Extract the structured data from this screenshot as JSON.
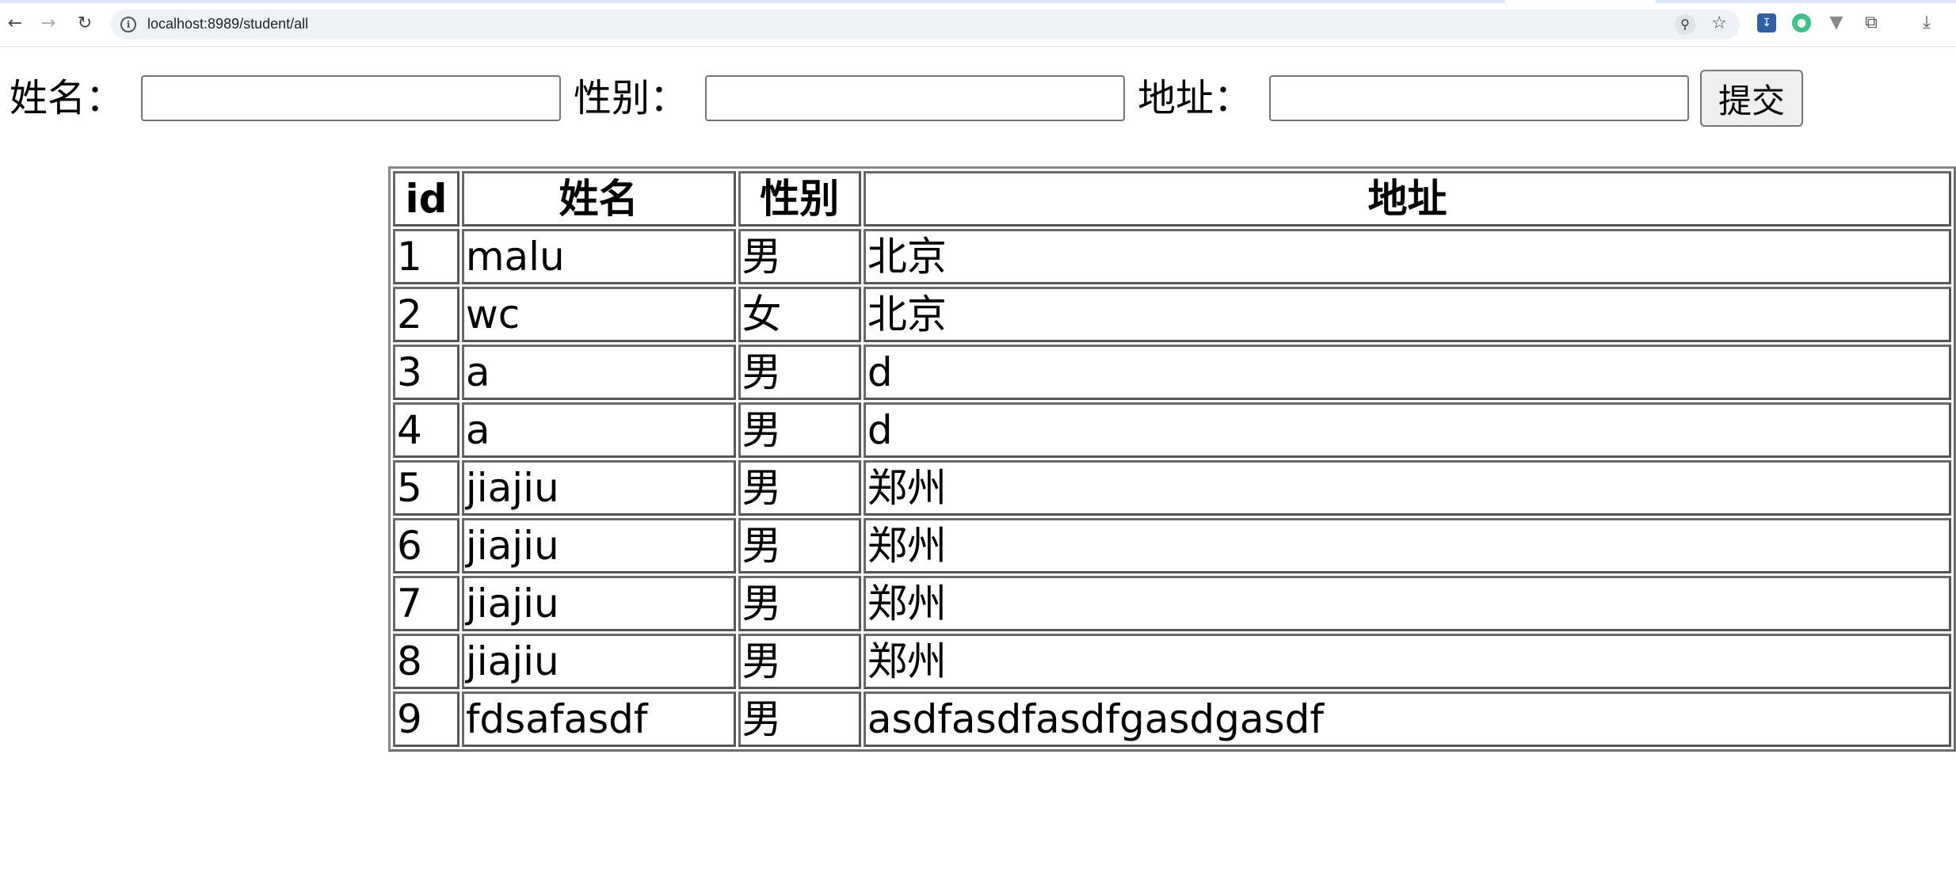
{
  "browser": {
    "url": "localhost:8989/student/all"
  },
  "form": {
    "name_label": "姓名：",
    "gender_label": "性别：",
    "address_label": "地址：",
    "name_value": "",
    "gender_value": "",
    "address_value": "",
    "submit_label": "提交"
  },
  "table": {
    "headers": {
      "id": "id",
      "name": "姓名",
      "gender": "性别",
      "address": "地址"
    },
    "rows": [
      {
        "id": "1",
        "name": "malu",
        "gender": "男",
        "address": "北京"
      },
      {
        "id": "2",
        "name": "wc",
        "gender": "女",
        "address": "北京"
      },
      {
        "id": "3",
        "name": "a",
        "gender": "男",
        "address": "d"
      },
      {
        "id": "4",
        "name": "a",
        "gender": "男",
        "address": "d"
      },
      {
        "id": "5",
        "name": "jiajiu",
        "gender": "男",
        "address": "郑州"
      },
      {
        "id": "6",
        "name": "jiajiu",
        "gender": "男",
        "address": "郑州"
      },
      {
        "id": "7",
        "name": "jiajiu",
        "gender": "男",
        "address": "郑州"
      },
      {
        "id": "8",
        "name": "jiajiu",
        "gender": "男",
        "address": "郑州"
      },
      {
        "id": "9",
        "name": "fdsafasdf",
        "gender": "男",
        "address": "asdfasdfasdfgasdgasdf"
      }
    ]
  }
}
